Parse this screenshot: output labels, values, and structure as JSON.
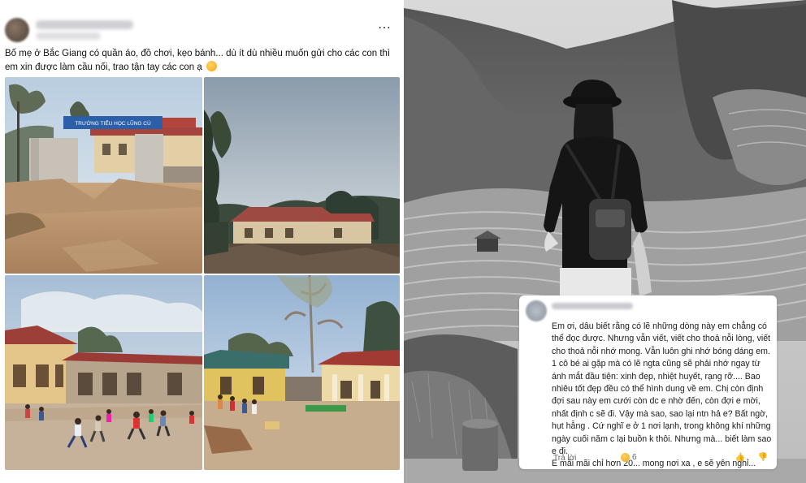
{
  "post": {
    "caption": "Bố mẹ ở Bắc Giang có quần áo, đồ chơi, kẹo bánh... dù ít dù nhiều muốn gửi cho các con thì em xin được làm cầu nối, trao tận tay các con ạ",
    "caption_emoji": "smiling-face-with-hearts",
    "more_icon": "⋯",
    "school_sign": "TRƯỜNG TIỂU HỌC LŨNG CÚ"
  },
  "comment": {
    "text": "Em ơi, dâu biết rằng có lẽ những dòng này em chẳng có thể đọc được. Nhưng vẫn viết, viết cho thoả nỗi lòng, viết cho thoả nỗi nhớ mong.  Vẫn luôn ghi nhớ bóng dáng em. 1 cô bé ai gặp mà có lẽ ngta cũng sẽ phải nhớ ngay từ ánh mắt đầu tiện: xinh đẹp, nhiệt huyết, rạng rỡ.... Bao nhiêu tốt đẹp đều có thể hình dung về em. Chị còn định đợi sau này em cưới còn dc e nhờ đến, còn đợi e mời, nhất định c sẽ đi. Vậy mà sao, sao lại ntn hả e? Bất ngờ, hụt hẫng . Cứ nghĩ e ở 1 nơi lạnh, trong không khí những ngày cuối năm c lại buồn k thôi. Nhưng mà... biết làm sao e đi.",
    "text2": "E mãi mãi chỉ hơn 20...  mong nơi xa , e sẽ yên nghỉ...",
    "reply_label": "Trả lời",
    "reaction_count": "6",
    "like_icon": "👍",
    "dislike_icon": "👎"
  }
}
